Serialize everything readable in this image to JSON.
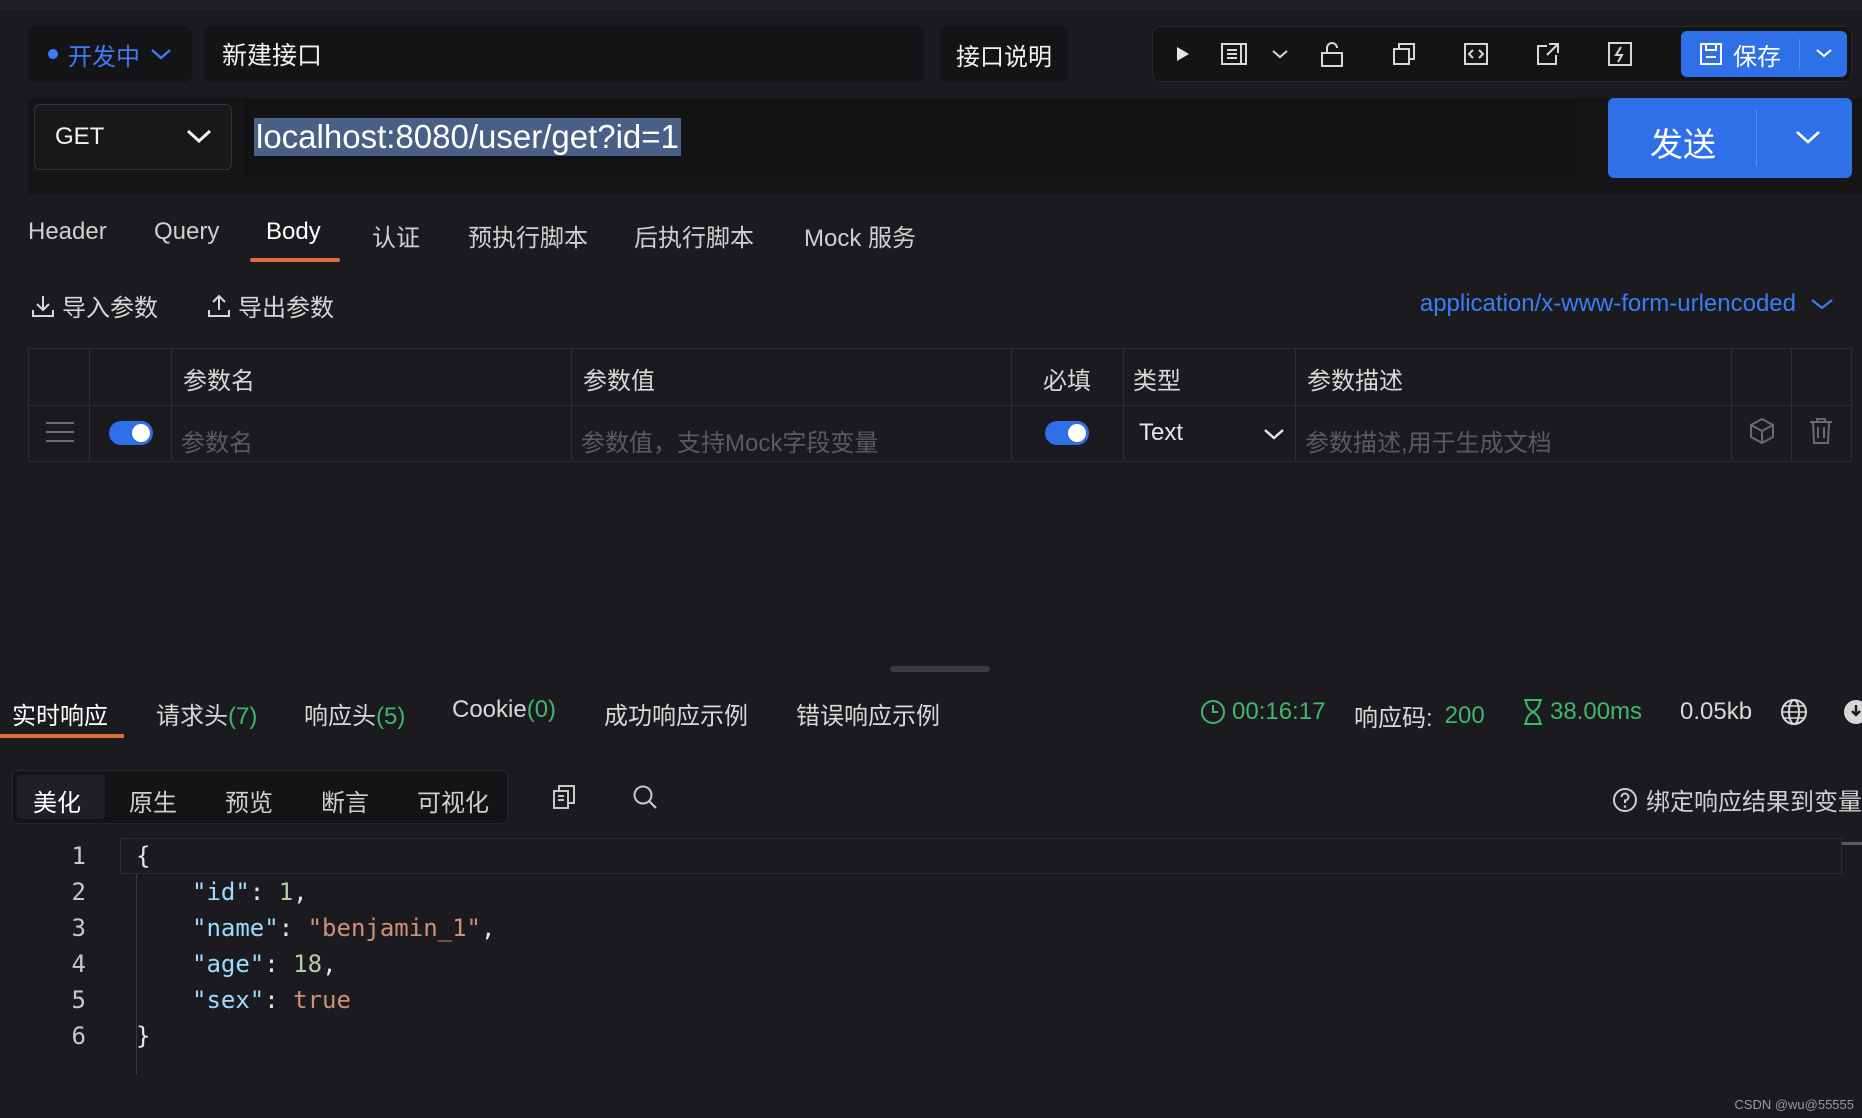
{
  "header": {
    "status_label": "开发中",
    "api_name": "新建接口",
    "desc_button": "接口说明",
    "save_label": "保存"
  },
  "request": {
    "method": "GET",
    "url": "localhost:8080/user/get?id=1",
    "send_label": "发送"
  },
  "tabs": {
    "header": "Header",
    "query": "Query",
    "body": "Body",
    "auth": "认证",
    "pre_script": "预执行脚本",
    "post_script": "后执行脚本",
    "mock": "Mock 服务"
  },
  "body_actions": {
    "import": "导入参数",
    "export": "导出参数",
    "content_type": "application/x-www-form-urlencoded"
  },
  "params_table": {
    "columns": [
      "参数名",
      "参数值",
      "必填",
      "类型",
      "参数描述"
    ],
    "row": {
      "name_placeholder": "参数名",
      "value_placeholder": "参数值，支持Mock字段变量",
      "type": "Text",
      "desc_placeholder": "参数描述,用于生成文档"
    }
  },
  "response_tabs": {
    "realtime": "实时响应",
    "req_headers": "请求头",
    "req_headers_count": "(7)",
    "resp_headers": "响应头",
    "resp_headers_count": "(5)",
    "cookie": "Cookie",
    "cookie_count": "(0)",
    "success_example": "成功响应示例",
    "error_example": "错误响应示例"
  },
  "response_info": {
    "time": "00:16:17",
    "code_label": "响应码:",
    "code": "200",
    "duration": "38.00ms",
    "size": "0.05kb"
  },
  "view_modes": [
    "美化",
    "原生",
    "预览",
    "断言",
    "可视化"
  ],
  "bind_label": "绑定响应结果到变量",
  "code_lines": [
    {
      "n": "1"
    },
    {
      "n": "2",
      "key": "\"id\"",
      "val": "1"
    },
    {
      "n": "3",
      "key": "\"name\"",
      "val": "\"benjamin_1\""
    },
    {
      "n": "4",
      "key": "\"age\"",
      "val": "18"
    },
    {
      "n": "5",
      "key": "\"sex\"",
      "val": "true"
    },
    {
      "n": "6"
    }
  ],
  "watermark": "CSDN @wu@55555"
}
